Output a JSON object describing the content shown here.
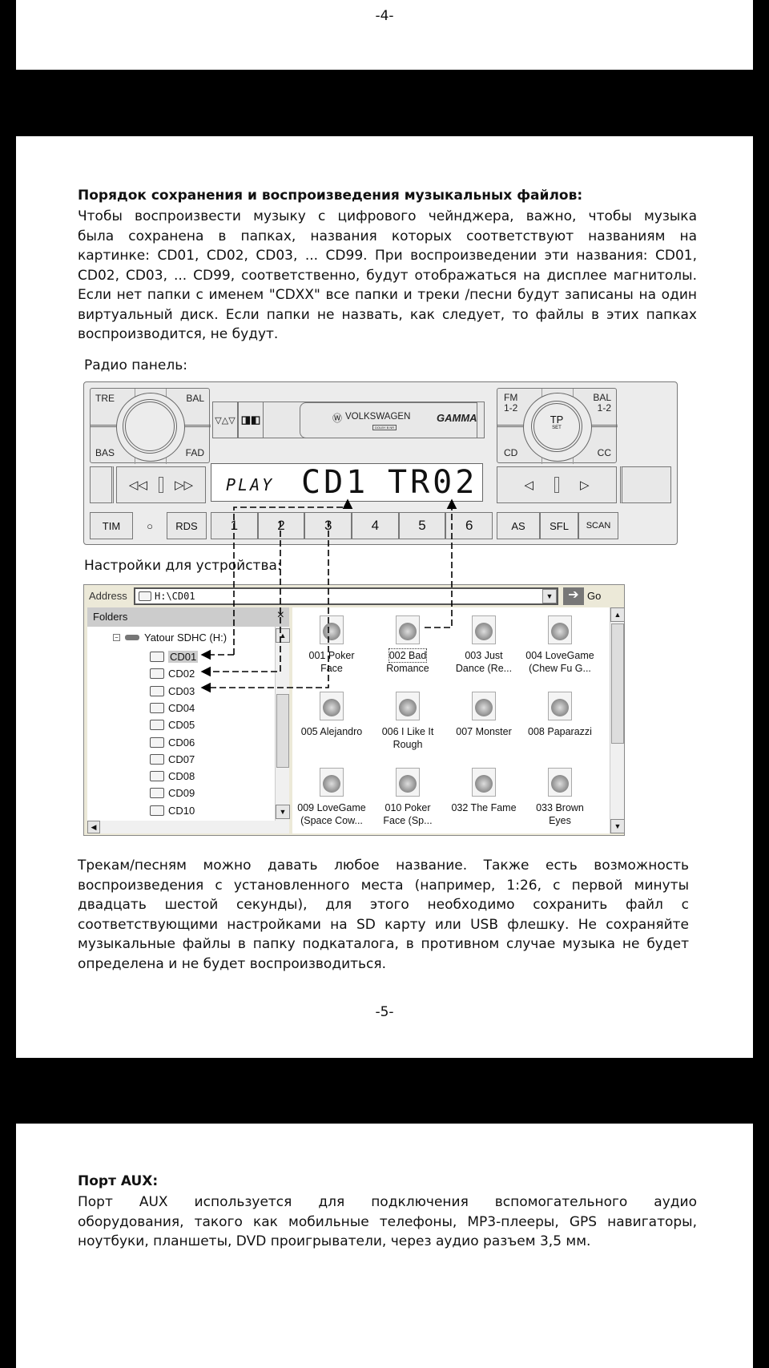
{
  "page_top": {
    "number": "-4-"
  },
  "page_main": {
    "heading": "Порядок сохранения и воспроизведения музыкальных файлов:",
    "intro_lines": [
      "Чтобы воспроизвести музыку с цифрового чейнджера, важно, чтобы музыка",
      "была сохранена в папках, названия которых соответствуют названиям на",
      "картинке:  CD01, CD02, CD03, ... CD99. При воспроизведении эти названия: CD01,",
      "CD02, CD03, ... CD99, соответственно, будут отображаться на дисплее магнитолы.",
      "Если нет папки с именем \"CDXX\" все папки и треки /песни будут записаны на один",
      "виртуальный диск. Если папки не назвать, как следует, то файлы в этих папках",
      "воспроизводится, не будут."
    ],
    "radio_label": "Радио панель:",
    "settings_label": "Настройки для устройства:",
    "outro_lines": [
      "Трекам/песням можно давать любое название. Также есть возможность",
      "воспроизведения с установленного места (например, 1:26, с первой минуты",
      "двадцать шестой секунды), для этого необходимо сохранить файл с",
      "соответствующими настройками на SD карту или USB флешку. Не сохраняйте",
      "музыкальные файлы в папку подкаталога, в противном случае музыка не будет",
      "определена и не будет воспроизводиться."
    ],
    "number": "-5-"
  },
  "radio": {
    "left_knob": {
      "tl": "TRE",
      "tr": "BAL",
      "bl": "BAS",
      "br": "FAD"
    },
    "right_knob": {
      "tl": "FM\n1-2",
      "tr": "BAL\n1-2",
      "bl": "CD",
      "br": "CC",
      "center": "TP",
      "center_sub": "SET"
    },
    "eject": "▽△▽",
    "dolby": "◨◧",
    "brand": "VOLKSWAGEN",
    "model": "GAMMA",
    "dolby_badge": "DOLBY B NR",
    "display": {
      "mode": "PLAY",
      "disc": "CD1",
      "track": "TR02"
    },
    "seek_left": "◁◁",
    "seek_right": "▷▷",
    "tune_left": "◁",
    "tune_right": "▷",
    "buttons_left": [
      "TIM",
      "○",
      "RDS"
    ],
    "presets": [
      "1",
      "2",
      "3",
      "4",
      "5",
      "6"
    ],
    "buttons_right": [
      "AS",
      "SFL",
      "SCAN"
    ]
  },
  "explorer": {
    "address_label": "Address",
    "address": "H:\\CD01",
    "go": "Go",
    "folders_title": "Folders",
    "close": "×",
    "drive": "Yatour SDHC (H:)",
    "folders": [
      "CD01",
      "CD02",
      "CD03",
      "CD04",
      "CD05",
      "CD06",
      "CD07",
      "CD08",
      "CD09",
      "CD10"
    ],
    "files": [
      [
        "001 Poker",
        "Face"
      ],
      [
        "002 Bad",
        "Romance"
      ],
      [
        "003 Just",
        "Dance (Re..."
      ],
      [
        "004 LoveGame",
        "(Chew Fu G..."
      ],
      [
        "005 Alejandro",
        ""
      ],
      [
        "006 I Like It",
        "Rough"
      ],
      [
        "007 Monster",
        ""
      ],
      [
        "008 Paparazzi",
        ""
      ],
      [
        "009 LoveGame",
        "(Space Cow..."
      ],
      [
        "010 Poker",
        "Face (Sp..."
      ],
      [
        "032 The Fame",
        ""
      ],
      [
        "033 Brown",
        "Eyes"
      ]
    ]
  },
  "page_bottom": {
    "heading": "Порт AUX:",
    "lines": [
      "Порт AUX используется для подключения вспомогательного аудио",
      "оборудования, такого как мобильные телефоны,  MP3-плееры, GPS навигаторы,",
      "ноутбуки, планшеты, DVD проигрыватели, через аудио разъем 3,5 мм."
    ]
  }
}
